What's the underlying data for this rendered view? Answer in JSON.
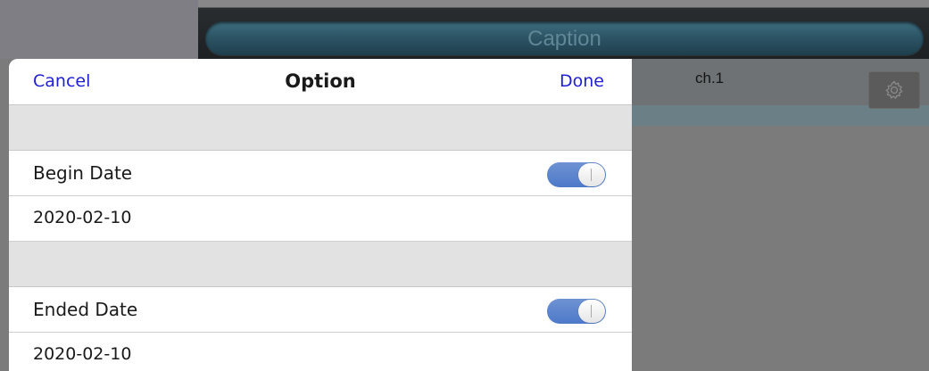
{
  "background": {
    "caption": "Caption",
    "channel": "ch.1",
    "settings_icon": "gear-icon"
  },
  "dialog": {
    "title": "Option",
    "cancel_label": "Cancel",
    "done_label": "Done",
    "accent_color": "#1f1fd4",
    "rows": [
      {
        "label": "Begin Date",
        "toggle_on": true,
        "value": "2020-02-10"
      },
      {
        "label": "Ended Date",
        "toggle_on": true,
        "value": "2020-02-10"
      }
    ]
  }
}
